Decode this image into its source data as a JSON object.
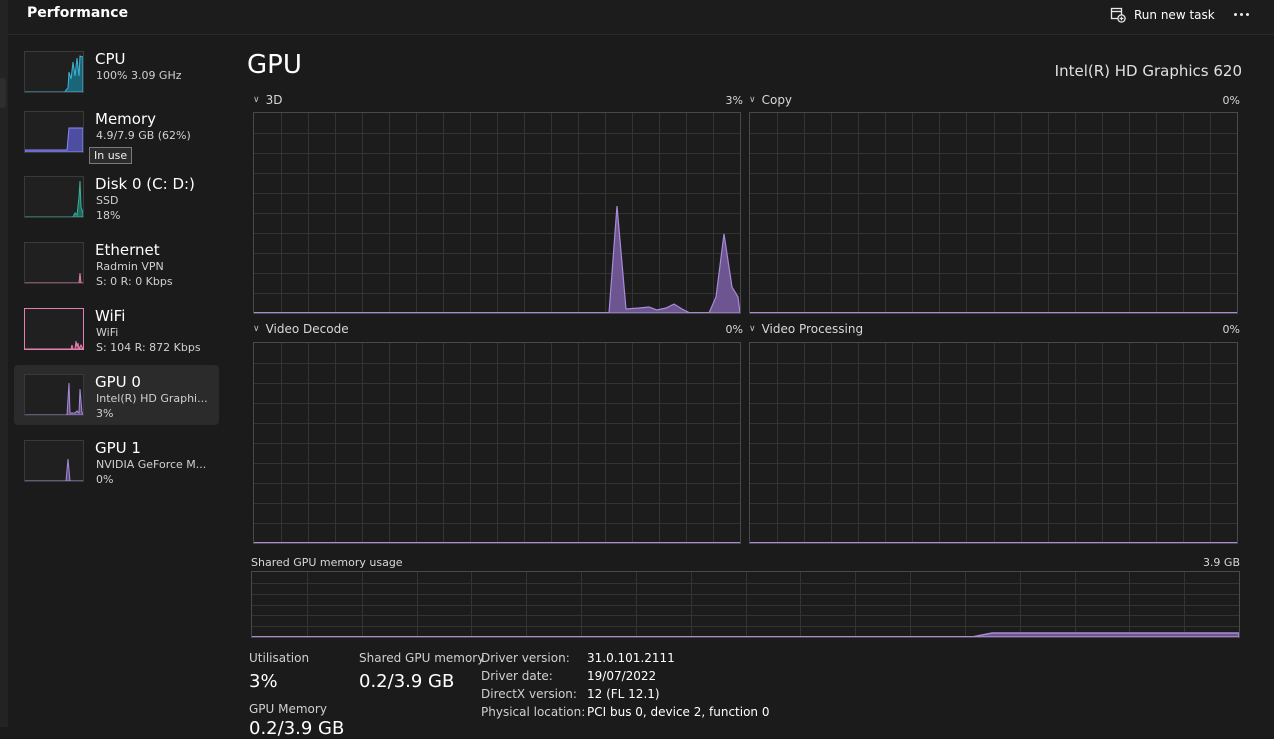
{
  "header": {
    "title": "Performance",
    "run_task_label": "Run new task",
    "run_task_icon": "run-task-icon",
    "more_icon": "more-options-icon"
  },
  "sidebar": {
    "items": [
      {
        "name": "CPU",
        "line1": "100%  3.09 GHz",
        "line2": "",
        "color": "#3fb4d2",
        "selected": false
      },
      {
        "name": "Memory",
        "line1": "4.9/7.9 GB (62%)",
        "line2": "",
        "color": "#8a88ff",
        "selected": false
      },
      {
        "name": "Disk 0 (C: D:)",
        "line1": "SSD",
        "line2": "18%",
        "color": "#3ab09e",
        "selected": false
      },
      {
        "name": "Ethernet",
        "line1": "Radmin VPN",
        "line2": "S: 0  R: 0 Kbps",
        "color": "#e37fb1",
        "selected": false
      },
      {
        "name": "WiFi",
        "line1": "WiFi",
        "line2": "S: 104  R: 872 Kbps",
        "color": "#e37fb1",
        "selected": false
      },
      {
        "name": "GPU 0",
        "line1": "Intel(R) HD Graphi...",
        "line2": "3%",
        "color": "#a98bd8",
        "selected": true
      },
      {
        "name": "GPU 1",
        "line1": "NVIDIA GeForce M...",
        "line2": "0%",
        "color": "#a98bd8",
        "selected": false
      }
    ],
    "tooltip": "In use"
  },
  "main": {
    "title": "GPU",
    "adapter": "Intel(R) HD Graphics 620",
    "accent_color": "#a98bd8",
    "graphs": [
      {
        "label": "3D",
        "value": "3%"
      },
      {
        "label": "Copy",
        "value": "0%"
      },
      {
        "label": "Video Decode",
        "value": "0%"
      },
      {
        "label": "Video Processing",
        "value": "0%"
      }
    ],
    "shared_memory": {
      "label": "Shared GPU memory usage",
      "max": "3.9 GB"
    }
  },
  "stats": {
    "utilisation_label": "Utilisation",
    "utilisation_value": "3%",
    "shared_label": "Shared GPU memory",
    "shared_value": "0.2/3.9 GB",
    "gpu_memory_label": "GPU Memory",
    "gpu_memory_value": "0.2/3.9 GB"
  },
  "info": [
    {
      "key": "Driver version:",
      "value": "31.0.101.2111"
    },
    {
      "key": "Driver date:",
      "value": "19/07/2022"
    },
    {
      "key": "DirectX version:",
      "value": "12 (FL 12.1)"
    },
    {
      "key": "Physical location:",
      "value": "PCI bus 0, device 2, function 0"
    }
  ]
}
